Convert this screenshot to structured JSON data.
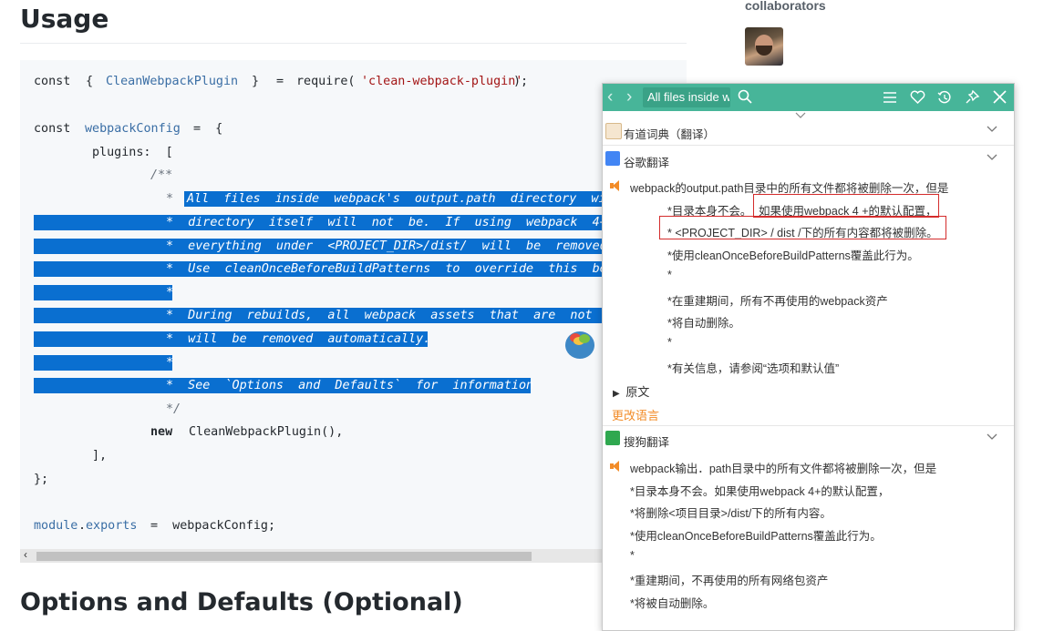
{
  "page": {
    "title": "Usage",
    "section_title": "Options and Defaults (Optional)",
    "collaborators_label": "collaborators"
  },
  "code": {
    "l1_a": "const",
    "l1_b": "{",
    "l1_c": "CleanWebpackPlugin",
    "l1_d": "}",
    "l1_e": "=",
    "l1_f": "require(",
    "l1_g": "'clean-webpack-plugin'",
    "l1_h": ");",
    "l2_a": "const",
    "l2_b": "webpackConfig",
    "l2_c": "=  {",
    "l3": "plugins:  [",
    "l4": "/**",
    "l5_star": "*",
    "l5": "All  files  inside  webpack's  output.path  directory  wi",
    "l6": "*  directory  itself  will  not  be.  If  using  webpack  4+",
    "l7": "*  everything  under  <PROJECT_DIR>/dist/  will  be  removed",
    "l8": "*  Use  cleanOnceBeforeBuildPatterns  to  override  this  be",
    "l9": "*",
    "l10": "*  During  rebuilds,  all  webpack  assets  that  are  not",
    "l11": "*  will  be  removed  automatically.",
    "l12": "*",
    "l13": "*  See  `Options  and  Defaults`  for  information",
    "l14": "*/",
    "l15_a": "new",
    "l15_b": "CleanWebpackPlugin(),",
    "l16": "],",
    "l17": "};",
    "l18_a": "module",
    "l18_b": ".",
    "l18_c": "exports",
    "l18_d": "=  webpackConfig;"
  },
  "popup": {
    "search_value": "All files inside w",
    "sections": {
      "youdao": "有道词典（翻译）",
      "google": "谷歌翻译",
      "sogou": "搜狗翻译"
    },
    "google_lines": [
      "webpack的output.path目录中的所有文件都将被删除一次，但是",
      "*目录本身不会。",
      "如果使用webpack 4 +的默认配置，",
      "* <PROJECT_DIR> / dist /下的所有内容都将被删除。",
      "*使用cleanOnceBeforeBuildPatterns覆盖此行为。",
      "*",
      "*在重建期间，所有不再使用的webpack资产",
      "*将自动删除。",
      "*",
      "*有关信息，请参阅“选项和默认值”"
    ],
    "original_label": "原文",
    "change_language": "更改语言",
    "sogou_lines": [
      "webpack输出．path目录中的所有文件都将被删除一次，但是",
      "*目录本身不会。如果使用webpack 4+的默认配置，",
      "*将删除<项目目录>/dist/下的所有内容。",
      "*使用cleanOnceBeforeBuildPatterns覆盖此行为。",
      "*",
      "*重建期间，不再使用的所有网络包资产",
      "*将被自动删除。"
    ]
  }
}
